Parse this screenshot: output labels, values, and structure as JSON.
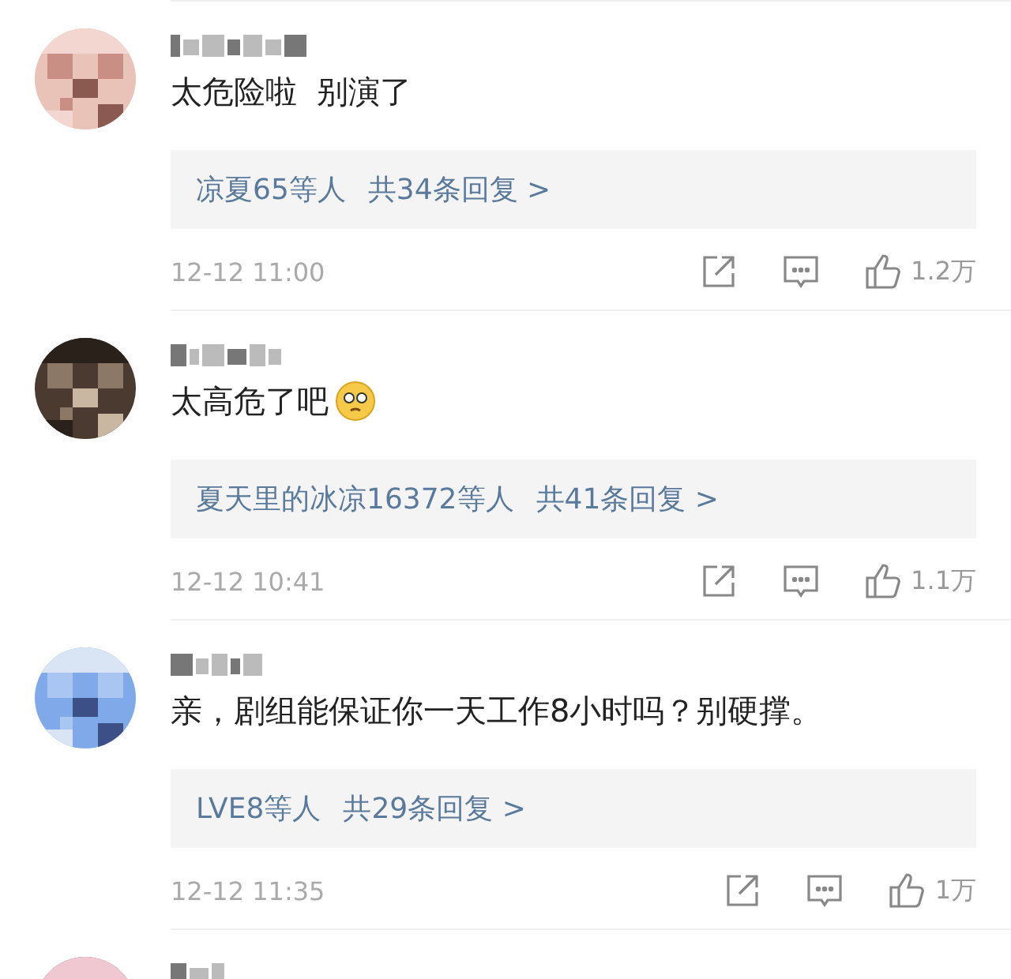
{
  "comments": [
    {
      "kind": "full",
      "text": "太危险啦  别演了",
      "emoji": false,
      "replies": {
        "who": "凉夏65等人",
        "total": "共34条回复 >"
      },
      "time": "12-12 11:00",
      "likes": "1.2万"
    },
    {
      "kind": "full",
      "text": "太高危了吧",
      "emoji": true,
      "replies": {
        "who": "夏天里的冰凉16372等人",
        "total": "共41条回复 >"
      },
      "time": "12-12 10:41",
      "likes": "1.1万"
    },
    {
      "kind": "full",
      "text": "亲，剧组能保证你一天工作8小时吗？别硬撑。",
      "emoji": false,
      "replies": {
        "who": "LVE8等人",
        "total": "共29条回复 >"
      },
      "time": "12-12 11:35",
      "likes": "1万"
    },
    {
      "kind": "cut_off"
    }
  ]
}
